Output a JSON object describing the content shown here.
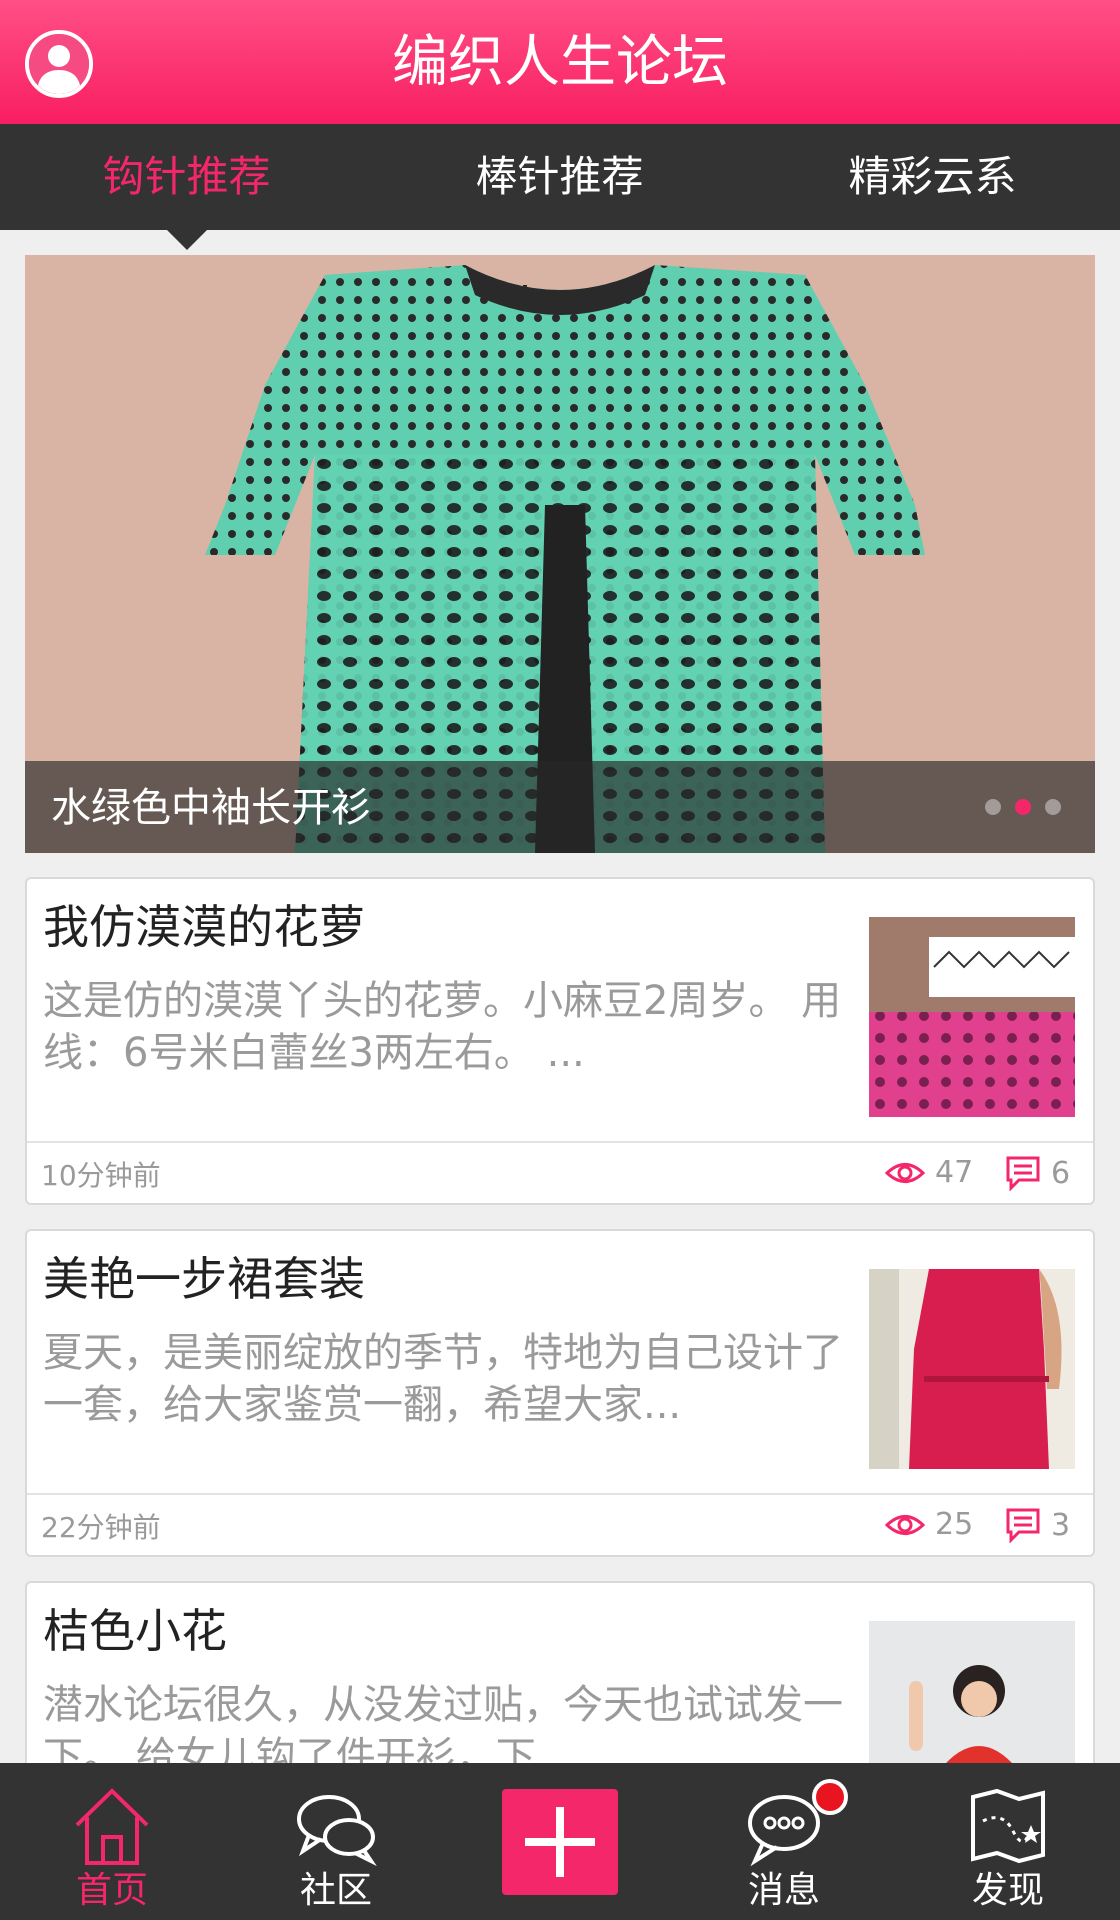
{
  "header": {
    "title": "编织人生论坛",
    "avatar_icon": "user-avatar-icon"
  },
  "tabs": [
    {
      "label": "钩针推荐",
      "active": true
    },
    {
      "label": "棒针推荐",
      "active": false
    },
    {
      "label": "精彩云系",
      "active": false
    }
  ],
  "banner": {
    "caption": "水绿色中袖长开衫",
    "slides": 3,
    "active_slide": 2
  },
  "posts": [
    {
      "title": "我仿漠漠的花萝",
      "summary": "这是仿的漠漠丫头的花萝。小麻豆2周岁。   用线：6号米白蕾丝3两左右。   ...",
      "time": "10分钟前",
      "views": "47",
      "comments": "6"
    },
    {
      "title": "美艳一步裙套装",
      "summary": "夏天，是美丽绽放的季节，特地为自己设计了一套，给大家鉴赏一翻，希望大家...",
      "time": "22分钟前",
      "views": "25",
      "comments": "3"
    },
    {
      "title": "桔色小花",
      "summary": "  潜水论坛很久，从没发过贴，今天也试试发一下。    给女儿钩了件开衫，下",
      "time": "",
      "views": "",
      "comments": ""
    }
  ],
  "bottom_nav": [
    {
      "label": "首页",
      "icon": "home-icon",
      "active": true
    },
    {
      "label": "社区",
      "icon": "chat-bubbles-icon",
      "active": false
    },
    {
      "label": "",
      "icon": "plus-icon",
      "active": false
    },
    {
      "label": "消息",
      "icon": "message-icon",
      "active": false,
      "badge": true
    },
    {
      "label": "发现",
      "icon": "map-icon",
      "active": false
    }
  ],
  "colors": {
    "accent": "#f5276b",
    "dark_bar": "#333333",
    "muted_text": "#9a9a9a"
  }
}
